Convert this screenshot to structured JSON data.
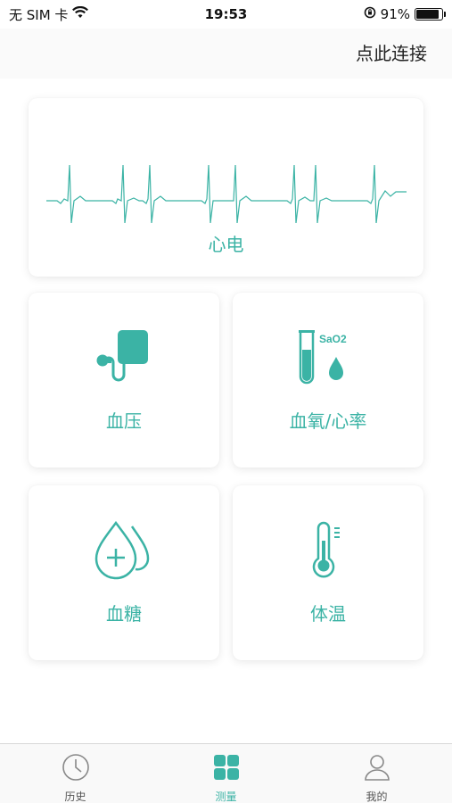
{
  "status_bar": {
    "carrier": "无 SIM 卡",
    "time": "19:53",
    "battery_percent_text": "91%",
    "battery_level": 0.91
  },
  "header": {
    "connect_label": "点此连接"
  },
  "accent_color": "#3bb3a5",
  "cards": {
    "ecg": {
      "label": "心电",
      "icon": "ecg-waveform-icon"
    },
    "blood_pressure": {
      "label": "血压",
      "icon": "blood-pressure-cuff-icon"
    },
    "spo2": {
      "label": "血氧/心率",
      "icon": "test-tube-drop-icon",
      "icon_text": "SaO2"
    },
    "glucose": {
      "label": "血糖",
      "icon": "blood-drop-plus-icon"
    },
    "temperature": {
      "label": "体温",
      "icon": "thermometer-icon"
    }
  },
  "tab_bar": {
    "tabs": [
      {
        "label": "历史",
        "icon": "clock-icon",
        "active": false
      },
      {
        "label": "测量",
        "icon": "grid-icon",
        "active": true
      },
      {
        "label": "我的",
        "icon": "user-icon",
        "active": false
      }
    ]
  }
}
